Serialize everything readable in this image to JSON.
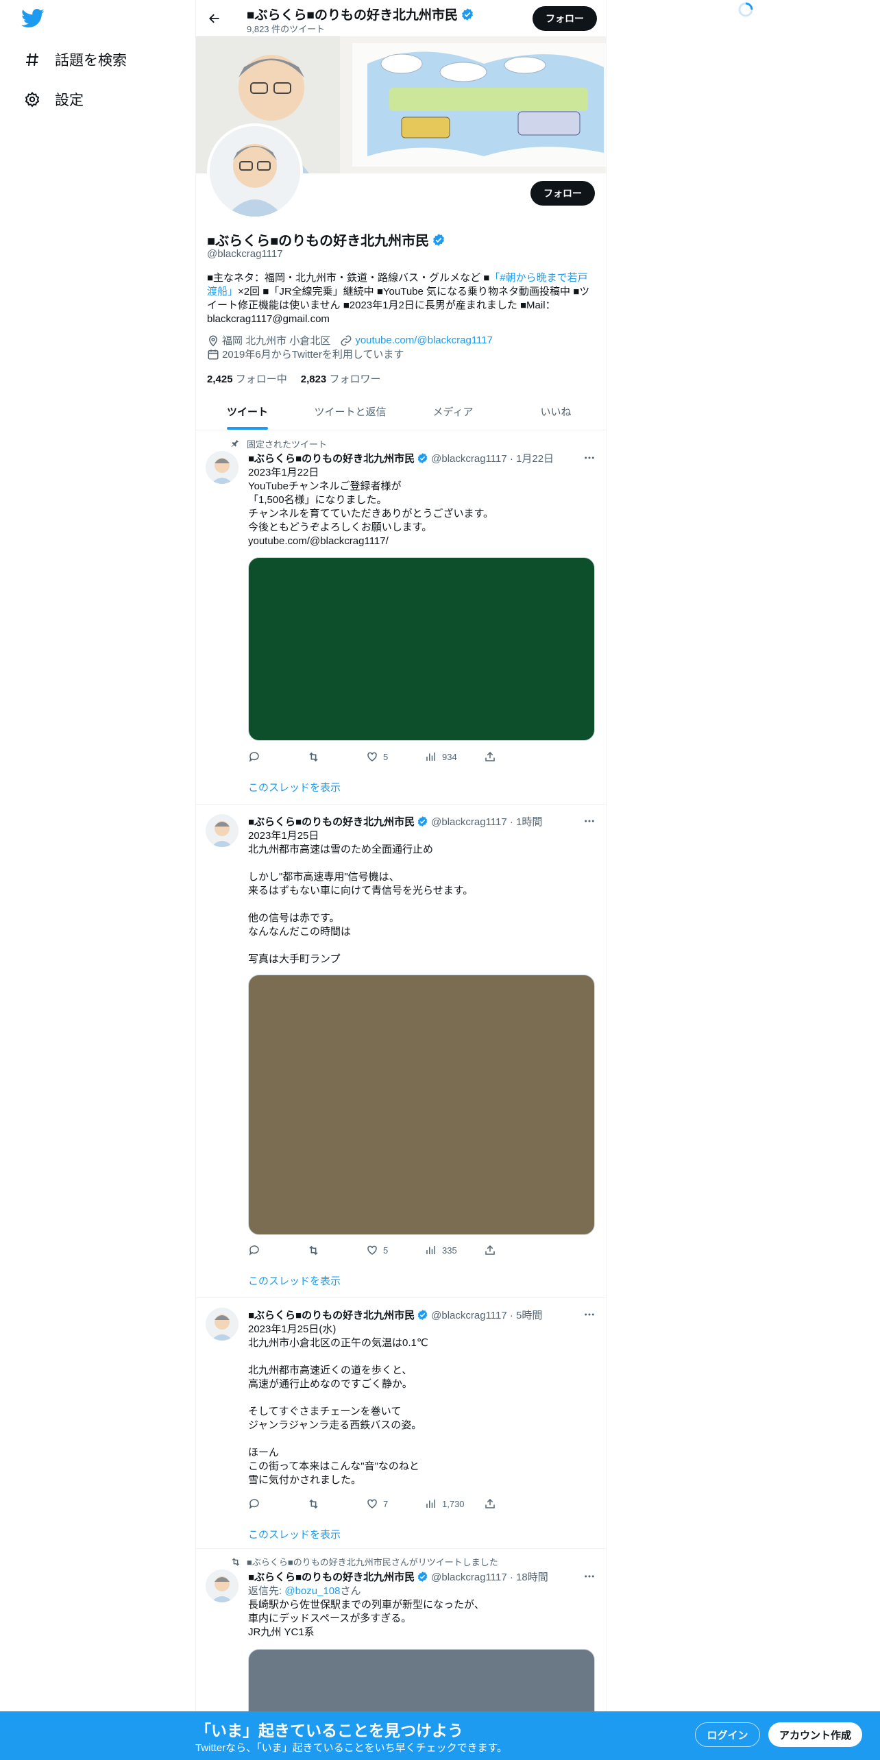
{
  "nav": {
    "items": [
      {
        "label": "話題を検索",
        "icon": "hashtag-icon"
      },
      {
        "label": "設定",
        "icon": "gear-icon"
      }
    ]
  },
  "header": {
    "name": "■ぶらくら■のりもの好き北九州市民",
    "tweet_count": "9,823 件のツイート",
    "follow_label": "フォロー"
  },
  "profile": {
    "name": "■ぶらくら■のりもの好き北九州市民",
    "handle": "@blackcrag1117",
    "follow_label": "フォロー",
    "bio_pre": "■主なネタ：福岡・北九州市・鉄道・路線バス・グルメなど ■",
    "bio_link": "「#朝から晩まで若戸渡船」",
    "bio_post": "×2回 ■「JR全線完乗」継続中 ■YouTube 気になる乗り物ネタ動画投稿中 ■ツイート修正機能は使いません ■2023年1月2日に長男が産まれました ■Mail：blackcrag1117@gmail.com",
    "location": "福岡 北九州市 小倉北区",
    "url": "youtube.com/@blackcrag1117",
    "joined": "2019年6月からTwitterを利用しています",
    "following_count": "2,425",
    "following_label": "フォロー中",
    "followers_count": "2,823",
    "followers_label": "フォロワー",
    "accent": "#1d9bf0"
  },
  "tabs": [
    {
      "label": "ツイート",
      "active": true
    },
    {
      "label": "ツイートと返信",
      "active": false
    },
    {
      "label": "メディア",
      "active": false
    },
    {
      "label": "いいね",
      "active": false
    }
  ],
  "tweets": [
    {
      "context": "固定されたツイート",
      "name": "■ぶらくら■のりもの好き北九州市民",
      "handle": "@blackcrag1117 · 1月22日",
      "text": "2023年1月22日\nYouTubeチャンネルご登録者様が\n「1,500名様」になりました。\nチャンネルを育てていただきありがとうございます。\n今後ともどうぞよろしくお願いします。",
      "link": "youtube.com/@blackcrag1117/",
      "media_color": "#0d4f2a",
      "likes": "5",
      "views": "934",
      "thread": "このスレッドを表示"
    },
    {
      "context": "",
      "name": "■ぶらくら■のりもの好き北九州市民",
      "handle": "@blackcrag1117 · 1時間",
      "text": "2023年1月25日\n北九州都市高速は雪のため全面通行止め\n\nしかし\"都市高速専用\"信号機は、\n来るはずもない車に向けて青信号を光らせます。\n\n他の信号は赤です。\nなんなんだこの時間は\n\n写真は大手町ランプ",
      "media_color": "#7a6d52",
      "likes": "5",
      "views": "335",
      "thread": "このスレッドを表示"
    },
    {
      "context": "",
      "name": "■ぶらくら■のりもの好き北九州市民",
      "handle": "@blackcrag1117 · 5時間",
      "text": "2023年1月25日(水)\n北九州市小倉北区の正午の気温は0.1℃\n\n北九州都市高速近くの道を歩くと、\n高速が通行止めなのですごく静か。\n\nそしてすぐさまチェーンを巻いて\nジャンラジャンラ走る西鉄バスの姿。\n\nほーん\nこの街って本来はこんな\"音\"なのねと\n雪に気付かされました。",
      "likes": "7",
      "views": "1,730",
      "thread": "このスレッドを表示"
    },
    {
      "context": "■ぶらくら■のりもの好き北九州市民さんがリツイートしました",
      "name": "■ぶらくら■のりもの好き北九州市民",
      "handle": "@blackcrag1117 · 18時間",
      "reply_prefix": "返信先: ",
      "reply_to": "@bozu_108",
      "reply_suffix": "さん",
      "text": "長崎駅から佐世保駅までの列車が新型になったが、\n車内にデッドスペースが多すぎる。\nJR九州 YC1系",
      "media_color": "#6b7885"
    }
  ],
  "bottombar": {
    "title": "「いま」起きていることを見つけよう",
    "subtitle": "Twitterなら、「いま」起きていることをいち早くチェックできます。",
    "login": "ログイン",
    "signup": "アカウント作成",
    "bg": "#1d9bf0"
  }
}
